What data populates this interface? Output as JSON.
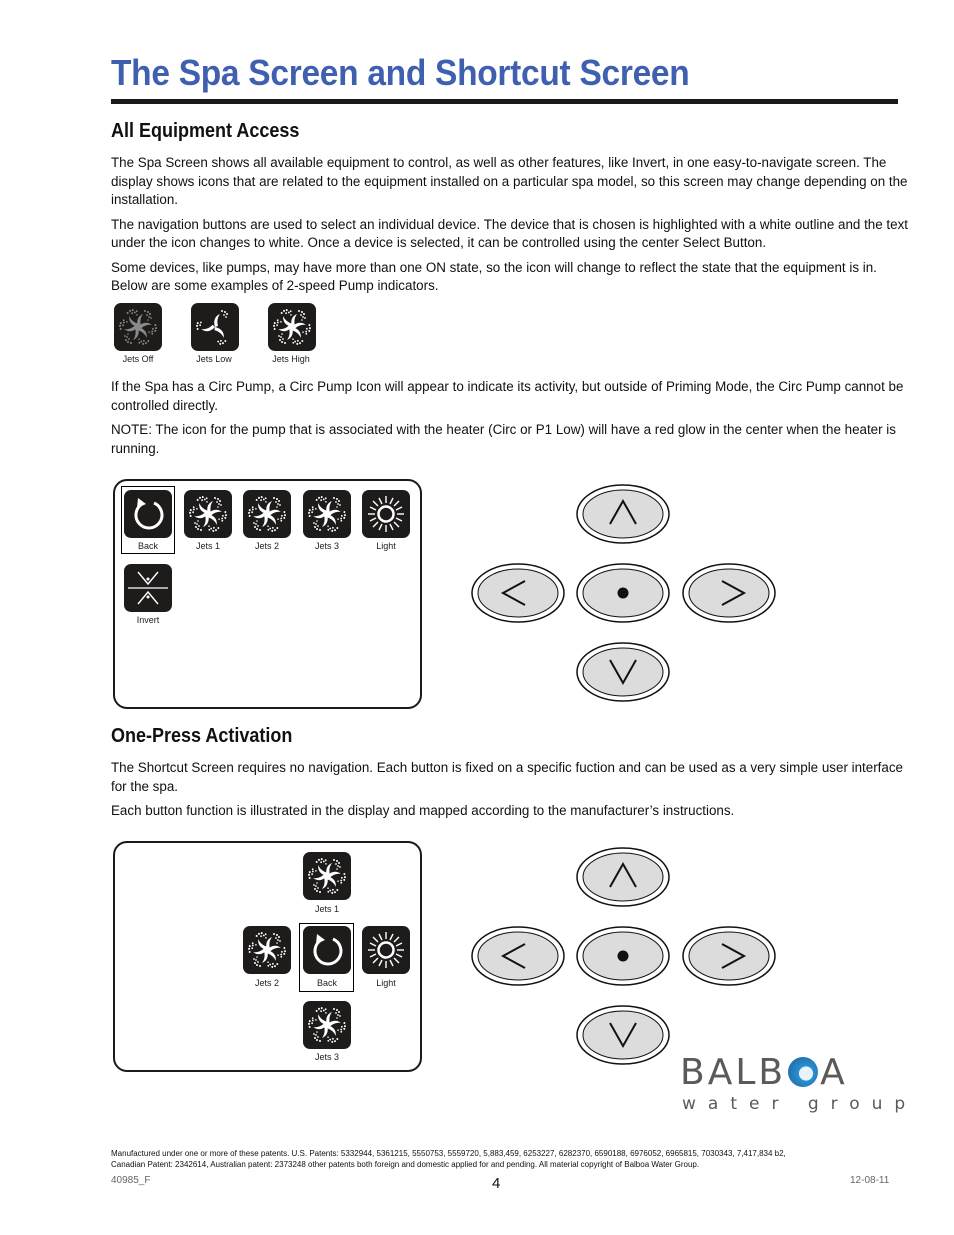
{
  "page": {
    "title": "The Spa Screen and Shortcut Screen"
  },
  "section1": {
    "heading": "All Equipment Access",
    "paragraphs": [
      "The Spa Screen shows all available equipment to control, as well as other features, like Invert, in one easy-to-navigate screen. The display shows icons that are related to the equipment installed on a particular spa model, so this screen may change depending on the installation.",
      "The navigation buttons are used to select an individual device. The device that is chosen is highlighted with a white outline and the text under the icon changes to white. Once a device is selected, it can be controlled using the center Select Button.",
      "Some devices, like pumps, may have more than one ON state, so the icon will change to reflect the state that the equipment is in. Below are some examples of 2-speed Pump indicators."
    ],
    "pump_examples": [
      {
        "label": "Jets Off",
        "icon": "jets-off-icon"
      },
      {
        "label": "Jets Low",
        "icon": "jets-low-icon"
      },
      {
        "label": "Jets High",
        "icon": "jets-high-icon"
      }
    ],
    "paragraphs2": [
      "If the Spa has a Circ Pump, a Circ Pump Icon will appear to indicate its activity, but outside of Priming Mode, the Circ Pump cannot be controlled directly.",
      "NOTE: The icon for the pump that is associated with the heater (Circ or P1 Low) will have a red glow in the center when the heater is running."
    ],
    "spa_screen": {
      "items": [
        {
          "label": "Back",
          "icon": "back-icon",
          "selected": true
        },
        {
          "label": "Jets 1",
          "icon": "jets-icon",
          "selected": false
        },
        {
          "label": "Jets 2",
          "icon": "jets-icon",
          "selected": false
        },
        {
          "label": "Jets 3",
          "icon": "jets-icon",
          "selected": false
        },
        {
          "label": "Light",
          "icon": "light-icon",
          "selected": false
        },
        {
          "label": "Invert",
          "icon": "invert-icon",
          "selected": false
        }
      ]
    }
  },
  "section2": {
    "heading": "One-Press Activation",
    "paragraphs": [
      "The Shortcut Screen requires no navigation. Each button is fixed on a specific fuction and can be used as a very simple user interface for the spa.",
      "Each button function is illustrated in the display and mapped according to the manufacturer’s instructions."
    ],
    "shortcut_screen": {
      "items": [
        {
          "label": "Jets 1",
          "icon": "jets-icon",
          "position": "top"
        },
        {
          "label": "Jets 2",
          "icon": "jets-icon",
          "position": "left"
        },
        {
          "label": "Back",
          "icon": "back-icon",
          "position": "center",
          "selected": true
        },
        {
          "label": "Light",
          "icon": "light-icon",
          "position": "right"
        },
        {
          "label": "Jets 3",
          "icon": "jets-icon",
          "position": "bottom"
        }
      ]
    }
  },
  "nav_pad": {
    "buttons": [
      "up",
      "left",
      "select",
      "right",
      "down"
    ],
    "button_fill": "#dcdcdc"
  },
  "logo": {
    "word": "BALB●A",
    "word_left": "BALB",
    "word_right": "A",
    "sub": "water group",
    "accent": "#2a8fd0",
    "text_color": "#5a5a5c"
  },
  "footer": {
    "patents_line1": "Manufactured under one or more of these patents.  U.S. Patents: 5332944, 5361215, 5550753, 5559720, 5,883,459, 6253227, 6282370, 6590188, 6976052, 6965815, 7030343, 7,417,834 b2,",
    "patents_line2": "Canadian Patent: 2342614, Australian patent: 2373248 other patents both foreign and domestic applied for and pending.   All material copyright of Balboa Water Group.",
    "doc_code": "40985_F",
    "page_number": "4",
    "date": "12-08-11"
  },
  "colors": {
    "title_blue": "#3f5fb0",
    "icon_bg": "#1e1b1b"
  }
}
